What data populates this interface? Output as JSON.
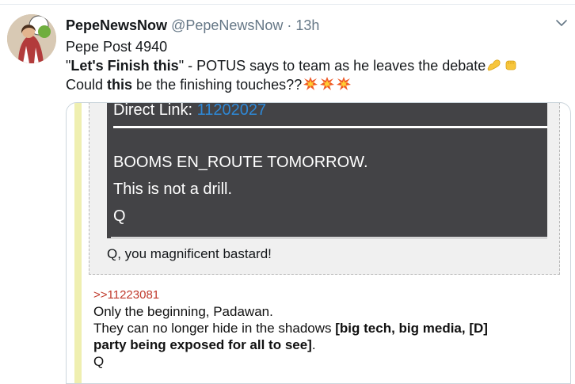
{
  "tweet": {
    "display_name": "PepeNewsNow",
    "handle": "@PepeNewsNow",
    "separator": " · ",
    "time": "13h",
    "line1": "Pepe Post 4940",
    "line2_q_open": "\"",
    "line2_bold": "Let's Finish this",
    "line2_rest": "\" - POTUS says to team as he leaves the debate",
    "line3_start": "Could ",
    "line3_bold": "this",
    "line3_rest": " be the finishing touches??",
    "icons": [
      "flexed-biceps-emoji",
      "fist-emoji",
      "collision-emoji"
    ]
  },
  "card": {
    "direct_link_label": "Direct Link: ",
    "direct_link_number": "11202027",
    "lines": [
      "BOOMS EN_ROUTE TOMORROW.",
      "This is not a drill.",
      "Q"
    ],
    "caption": "Q, you magnificent bastard!",
    "reply": {
      "ref": ">>11223081",
      "line1": "Only the beginning, Padawan.",
      "line2_plain": "They can no longer hide in the shadows ",
      "line2_bold": "[big tech, big media, [D]",
      "line3_bold": "party being exposed for all to see]",
      "line3_plain": ".",
      "line4": "Q"
    }
  }
}
